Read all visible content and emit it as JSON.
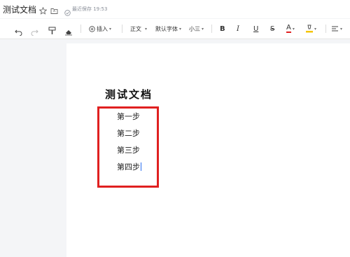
{
  "titlebar": {
    "doc_title": "测试文档",
    "save_status": "最近保存 19:53",
    "star_icon": "star-icon",
    "folder_icon": "folder-icon",
    "saved_icon": "check-circle-icon"
  },
  "toolbar": {
    "undo_icon": "undo-icon",
    "redo_icon": "redo-icon",
    "format_painter_icon": "format-painter-icon",
    "eraser_icon": "eraser-icon",
    "insert_label": "插入",
    "paragraph_style": "正文",
    "font_family": "默认字体",
    "font_size": "小三",
    "bold_label": "B",
    "italic_label": "I",
    "underline_label": "U",
    "strike_label": "S",
    "font_color_label": "A",
    "font_color": "#e02020",
    "highlight_color": "#f5c400",
    "align_icon": "align-icon"
  },
  "document": {
    "heading": "测试文档",
    "steps": [
      "第一步",
      "第二步",
      "第三步",
      "第四步"
    ]
  },
  "colors": {
    "annotation_box": "#e02020",
    "cursor": "#2a6ef0"
  }
}
